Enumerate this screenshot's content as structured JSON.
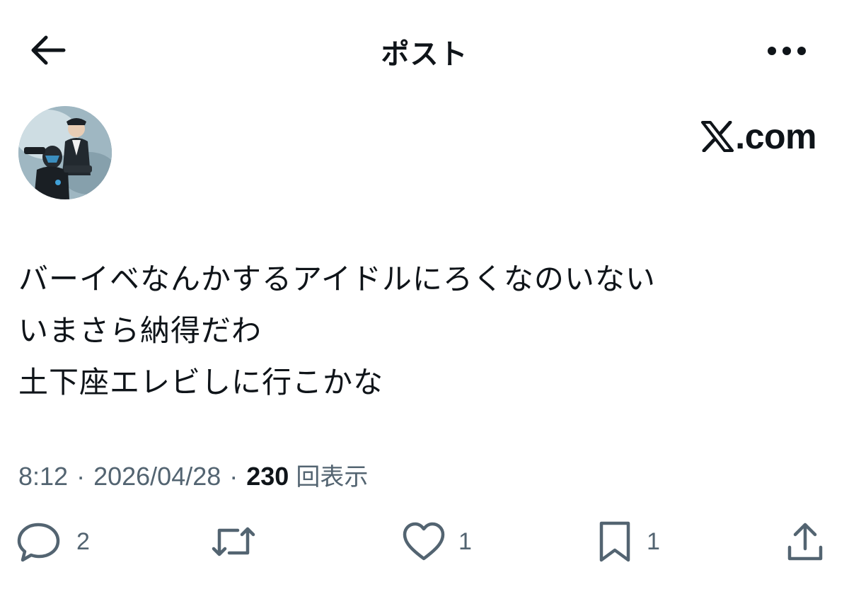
{
  "header": {
    "title": "ポスト"
  },
  "author": {
    "watermark_domain": ".com"
  },
  "post": {
    "lines": [
      "バーイベなんかするアイドルにろくなのいない",
      "いまさら納得だわ",
      "土下座エレビしに行こかな"
    ],
    "time": "8:12",
    "date": "2026/04/28",
    "views_count": "230",
    "views_label": "回表示",
    "separator": "·"
  },
  "actions": {
    "reply_count": "2",
    "repost_count": "",
    "like_count": "1",
    "bookmark_count": "1"
  },
  "icons": {
    "back": "arrow-left-icon",
    "more": "more-horizontal-icon",
    "reply": "comment-bubble-icon",
    "repost": "repost-arrows-icon",
    "like": "heart-icon",
    "bookmark": "bookmark-icon",
    "share": "share-upload-icon",
    "logo": "x-logo-icon"
  },
  "colors": {
    "text": "#0f1419",
    "secondary": "#536471",
    "background": "#ffffff"
  }
}
